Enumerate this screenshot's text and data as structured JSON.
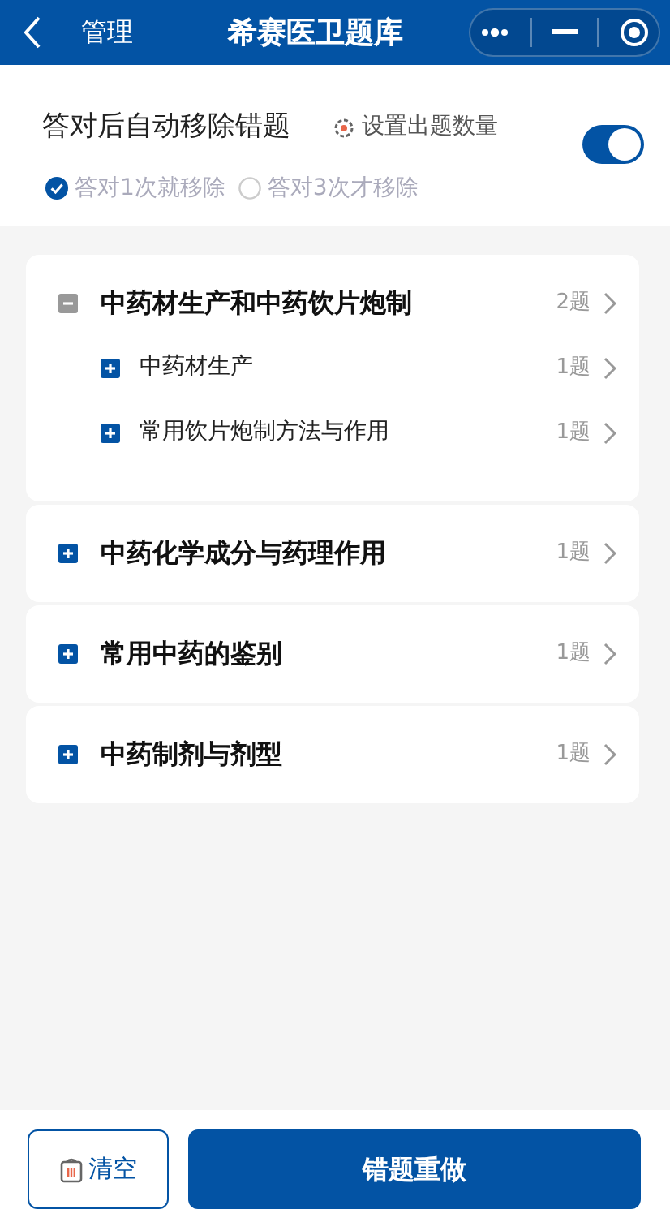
{
  "header": {
    "back_label": "管理",
    "title": "希赛医卫题库"
  },
  "settings": {
    "label": "答对后自动移除错题",
    "link": "设置出题数量",
    "auto_remove": {
      "on": true
    },
    "options": [
      {
        "label": "答对1次就移除",
        "selected": true
      },
      {
        "label": "答对3次才移除",
        "selected": false
      }
    ]
  },
  "chapters": [
    {
      "title": "中药材生产和中药饮片炮制",
      "count": "2题",
      "expanded": true,
      "children": [
        {
          "title": "中药材生产",
          "count": "1题",
          "expanded": false
        },
        {
          "title": "常用饮片炮制方法与作用",
          "count": "1题",
          "expanded": false
        }
      ]
    },
    {
      "title": "中药化学成分与药理作用",
      "count": "1题",
      "expanded": false
    },
    {
      "title": "常用中药的鉴别",
      "count": "1题",
      "expanded": false
    },
    {
      "title": "中药制剂与剂型",
      "count": "1题",
      "expanded": false
    }
  ],
  "footer": {
    "clear": "清空",
    "redo": "错题重做"
  }
}
